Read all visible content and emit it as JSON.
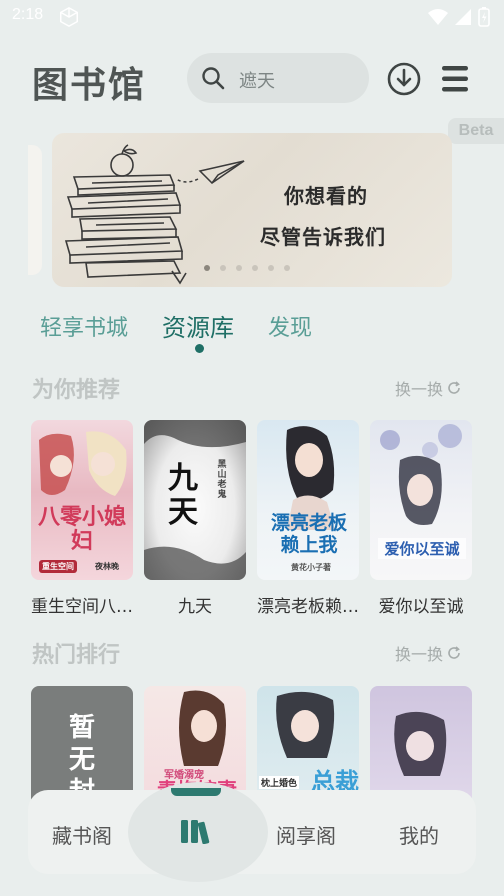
{
  "status_bar": {
    "time": "2:18"
  },
  "header": {
    "title": "图书馆",
    "search_placeholder": "遮天"
  },
  "beta_label": "Beta",
  "banner": {
    "line1": "你想看的",
    "line2": "尽管告诉我们",
    "dots": 6,
    "active_dot": 0
  },
  "tabs": [
    {
      "label": "轻享书城"
    },
    {
      "label": "资源库"
    },
    {
      "label": "发现"
    }
  ],
  "recommend": {
    "title": "为你推荐",
    "refresh_label": "换一换",
    "books": [
      {
        "title": "重生空间八…",
        "cover_text": "八零小媳妇",
        "cover_badge": "重生空间",
        "cover_author": "夜林晚"
      },
      {
        "title": "九天",
        "cover_text": "九天",
        "cover_author": "黑山老鬼"
      },
      {
        "title": "漂亮老板赖…",
        "cover_text": "漂亮老板赖上我",
        "cover_author": "黄花小子著"
      },
      {
        "title": "爱你以至诚",
        "cover_text": "爱你以至诚"
      }
    ]
  },
  "ranking": {
    "title": "热门排行",
    "refresh_label": "换一换",
    "books": [
      {
        "cover_text": "暂无封"
      },
      {
        "cover_text": "青梅嫁妻",
        "cover_subtitle": "军婚溺宠"
      },
      {
        "cover_text": "总裁",
        "cover_subtitle": "枕上婚色"
      },
      {
        "cover_text": ""
      }
    ]
  },
  "bottom_nav": [
    {
      "label": "藏书阁"
    },
    {
      "label": "书架"
    },
    {
      "label": "阅享阁"
    },
    {
      "label": "我的"
    }
  ]
}
